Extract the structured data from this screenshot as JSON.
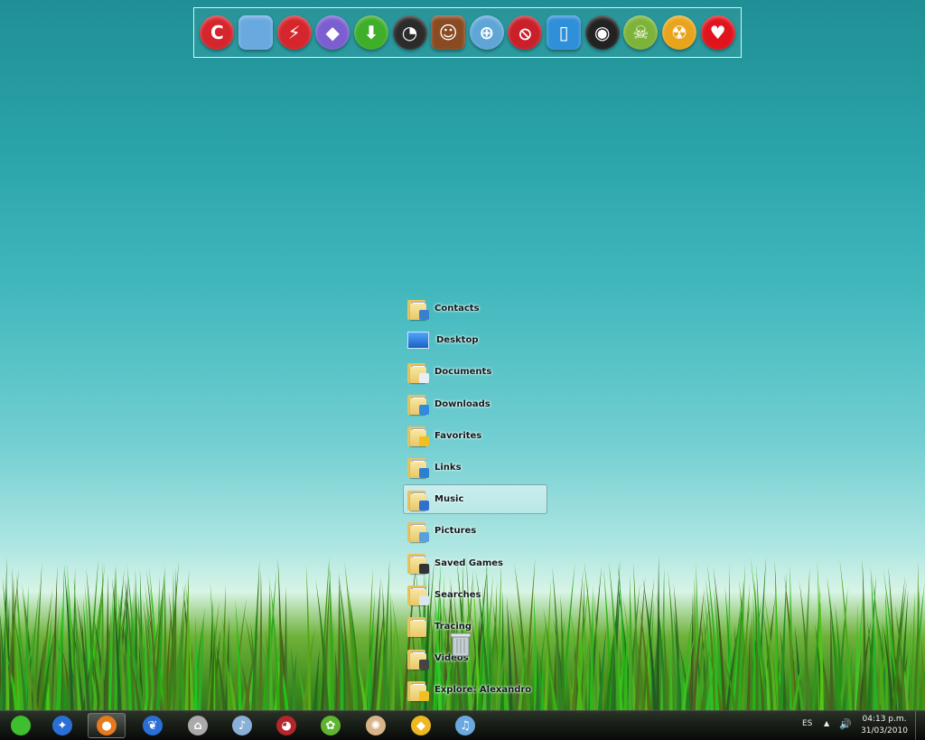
{
  "dock": {
    "items": [
      {
        "name": "red-hand-icon",
        "glyph": "C",
        "color": "#d4262c"
      },
      {
        "name": "blue-folder-icon",
        "glyph": "",
        "color": "#6aa9e0"
      },
      {
        "name": "lightning-icon",
        "glyph": "⚡",
        "color": "#d4262c"
      },
      {
        "name": "purple-gem-icon",
        "glyph": "◆",
        "color": "#7b5fd0"
      },
      {
        "name": "download-icon",
        "glyph": "⬇",
        "color": "#3fae2a"
      },
      {
        "name": "speedometer-icon",
        "glyph": "◔",
        "color": "#2b2b2b"
      },
      {
        "name": "popsicle-icon",
        "glyph": "☺",
        "color": "#8a4a22"
      },
      {
        "name": "crosshair-icon",
        "glyph": "⊕",
        "color": "#5fa6d6"
      },
      {
        "name": "no-entry-icon",
        "glyph": "⦸",
        "color": "#c9202a"
      },
      {
        "name": "ipod-icon",
        "glyph": "▯",
        "color": "#2f8fd8"
      },
      {
        "name": "camera-lens-icon",
        "glyph": "◉",
        "color": "#222222"
      },
      {
        "name": "skull-icon",
        "glyph": "☠",
        "color": "#7eb33a"
      },
      {
        "name": "radiation-icon",
        "glyph": "☢",
        "color": "#e8a51c"
      },
      {
        "name": "heart-icon",
        "glyph": "♥",
        "color": "#e0141c"
      }
    ]
  },
  "stack": {
    "items": [
      {
        "label": "Contacts",
        "badge": "#3b7fd0"
      },
      {
        "label": "Desktop",
        "badge": ""
      },
      {
        "label": "Documents",
        "badge": "#e9eef5"
      },
      {
        "label": "Downloads",
        "badge": "#2f8ae0"
      },
      {
        "label": "Favorites",
        "badge": "#f0c020"
      },
      {
        "label": "Links",
        "badge": "#2f7fd0"
      },
      {
        "label": "Music",
        "badge": "#2f6fd0"
      },
      {
        "label": "Pictures",
        "badge": "#5aa0e0"
      },
      {
        "label": "Saved Games",
        "badge": "#333333"
      },
      {
        "label": "Searches",
        "badge": "#dde6ee"
      },
      {
        "label": "Tracing",
        "badge": ""
      },
      {
        "label": "Videos",
        "badge": "#444444"
      },
      {
        "label": "Explore: Alexandro",
        "badge": "#f0c020"
      }
    ],
    "selected": "Music"
  },
  "taskbar": {
    "items": [
      {
        "name": "apple-start-icon",
        "glyph": "",
        "color": "#3fbf2f"
      },
      {
        "name": "safari-compass-icon",
        "glyph": "✦",
        "color": "#2a6fd6"
      },
      {
        "name": "firefox-icon",
        "glyph": "●",
        "color": "#e67a1c"
      },
      {
        "name": "blue-feather-icon",
        "glyph": "❦",
        "color": "#2a6fd6"
      },
      {
        "name": "network-computer-icon",
        "glyph": "⌂",
        "color": "#aaaaaa"
      },
      {
        "name": "guitar-icon",
        "glyph": "♪",
        "color": "#8ab0d8"
      },
      {
        "name": "ninja-icon",
        "glyph": "◕",
        "color": "#b3262c"
      },
      {
        "name": "green-gecko-icon",
        "glyph": "✿",
        "color": "#5fb52f"
      },
      {
        "name": "palette-icon",
        "glyph": "✺",
        "color": "#d9b48a"
      },
      {
        "name": "pedestrian-sign-icon",
        "glyph": "◆",
        "color": "#f0b820"
      },
      {
        "name": "itunes-icon",
        "glyph": "♫",
        "color": "#6aa9e0"
      }
    ],
    "active_index": 2,
    "language": "ES",
    "time": "04:13 p.m.",
    "date": "31/03/2010"
  }
}
